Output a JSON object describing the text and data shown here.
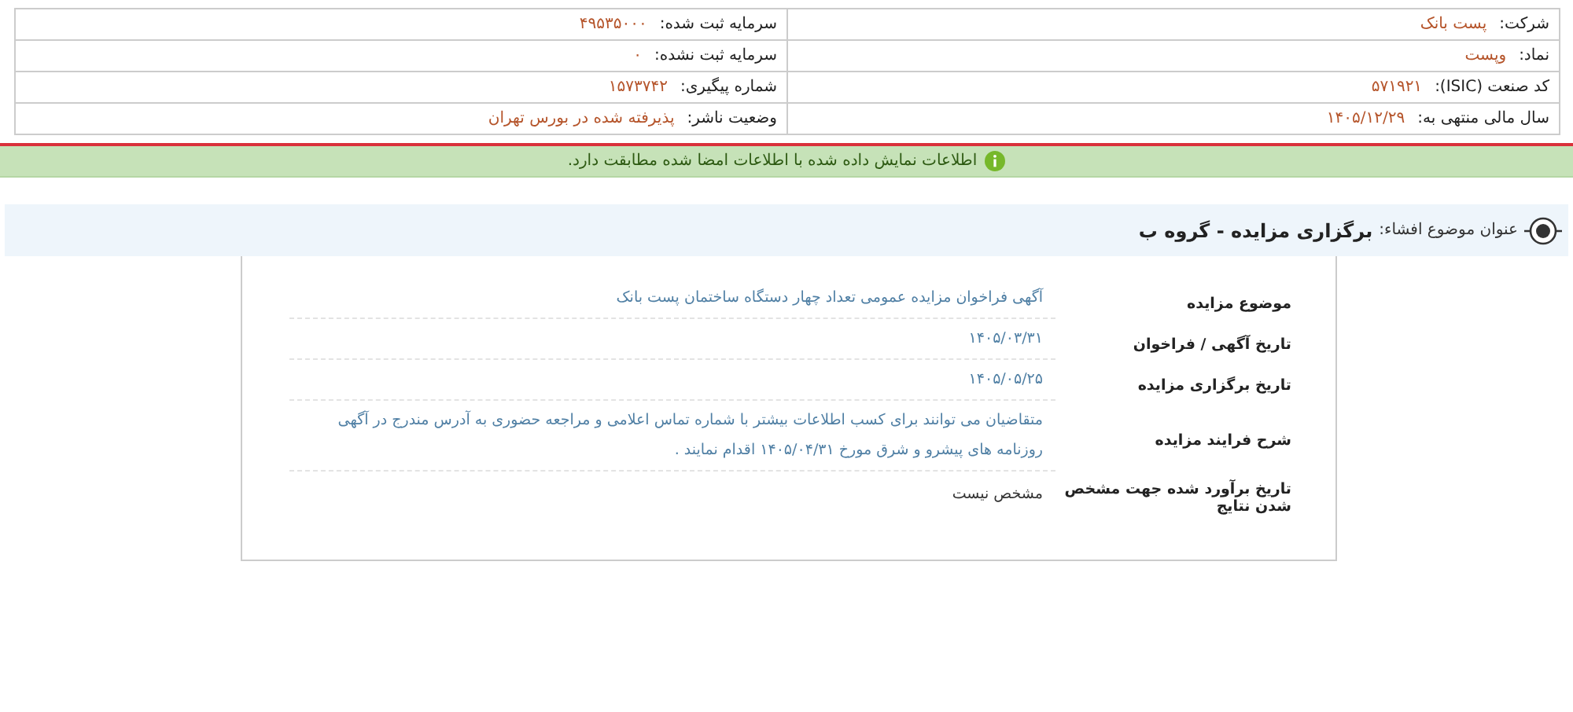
{
  "company_info": {
    "rows": [
      {
        "right": {
          "label": "شرکت:",
          "value": "پست بانک"
        },
        "left": {
          "label": "سرمایه ثبت شده:",
          "value": "۴۹۵۳۵۰۰۰"
        }
      },
      {
        "right": {
          "label": "نماد:",
          "value": "وپست"
        },
        "left": {
          "label": "سرمایه ثبت نشده:",
          "value": "۰"
        }
      },
      {
        "right": {
          "label": "کد صنعت (ISIC):",
          "value": "۵۷۱۹۲۱"
        },
        "left": {
          "label": "شماره پیگیری:",
          "value": "۱۵۷۳۷۴۲"
        }
      },
      {
        "right": {
          "label": "سال مالی منتهی به:",
          "value": "۱۴۰۵/۱۲/۲۹"
        },
        "left": {
          "label": "وضعیت ناشر:",
          "value": "پذیرفته شده در بورس تهران"
        }
      }
    ]
  },
  "notice": {
    "text": "اطلاعات نمایش داده شده با اطلاعات امضا شده مطابقت دارد."
  },
  "disclosure": {
    "label": "عنوان موضوع افشاء:",
    "title": "برگزاری مزایده - گروه ب"
  },
  "details": [
    {
      "label": "موضوع مزایده",
      "value": "آگهی فراخوان مزایده عمومی تعداد چهار دستگاه ساختمان پست بانک"
    },
    {
      "label": "تاریخ آگهی / فراخوان",
      "value": "۱۴۰۵/۰۳/۳۱"
    },
    {
      "label": "تاریخ برگزاری مزایده",
      "value": "۱۴۰۵/۰۵/۲۵"
    },
    {
      "label": "شرح فرایند مزایده",
      "value": "متقاضیان می توانند برای کسب اطلاعات بیشتر با شماره تماس اعلامی و مراجعه حضوری به آدرس مندرج در آگهی روزنامه های پیشرو و شرق مورخ ۱۴۰۵/۰۴/۳۱ اقدام نمایند ."
    },
    {
      "label": "تاریخ برآورد شده جهت مشخص شدن نتایج",
      "value": "مشخص نیست",
      "kind": "plain"
    }
  ]
}
